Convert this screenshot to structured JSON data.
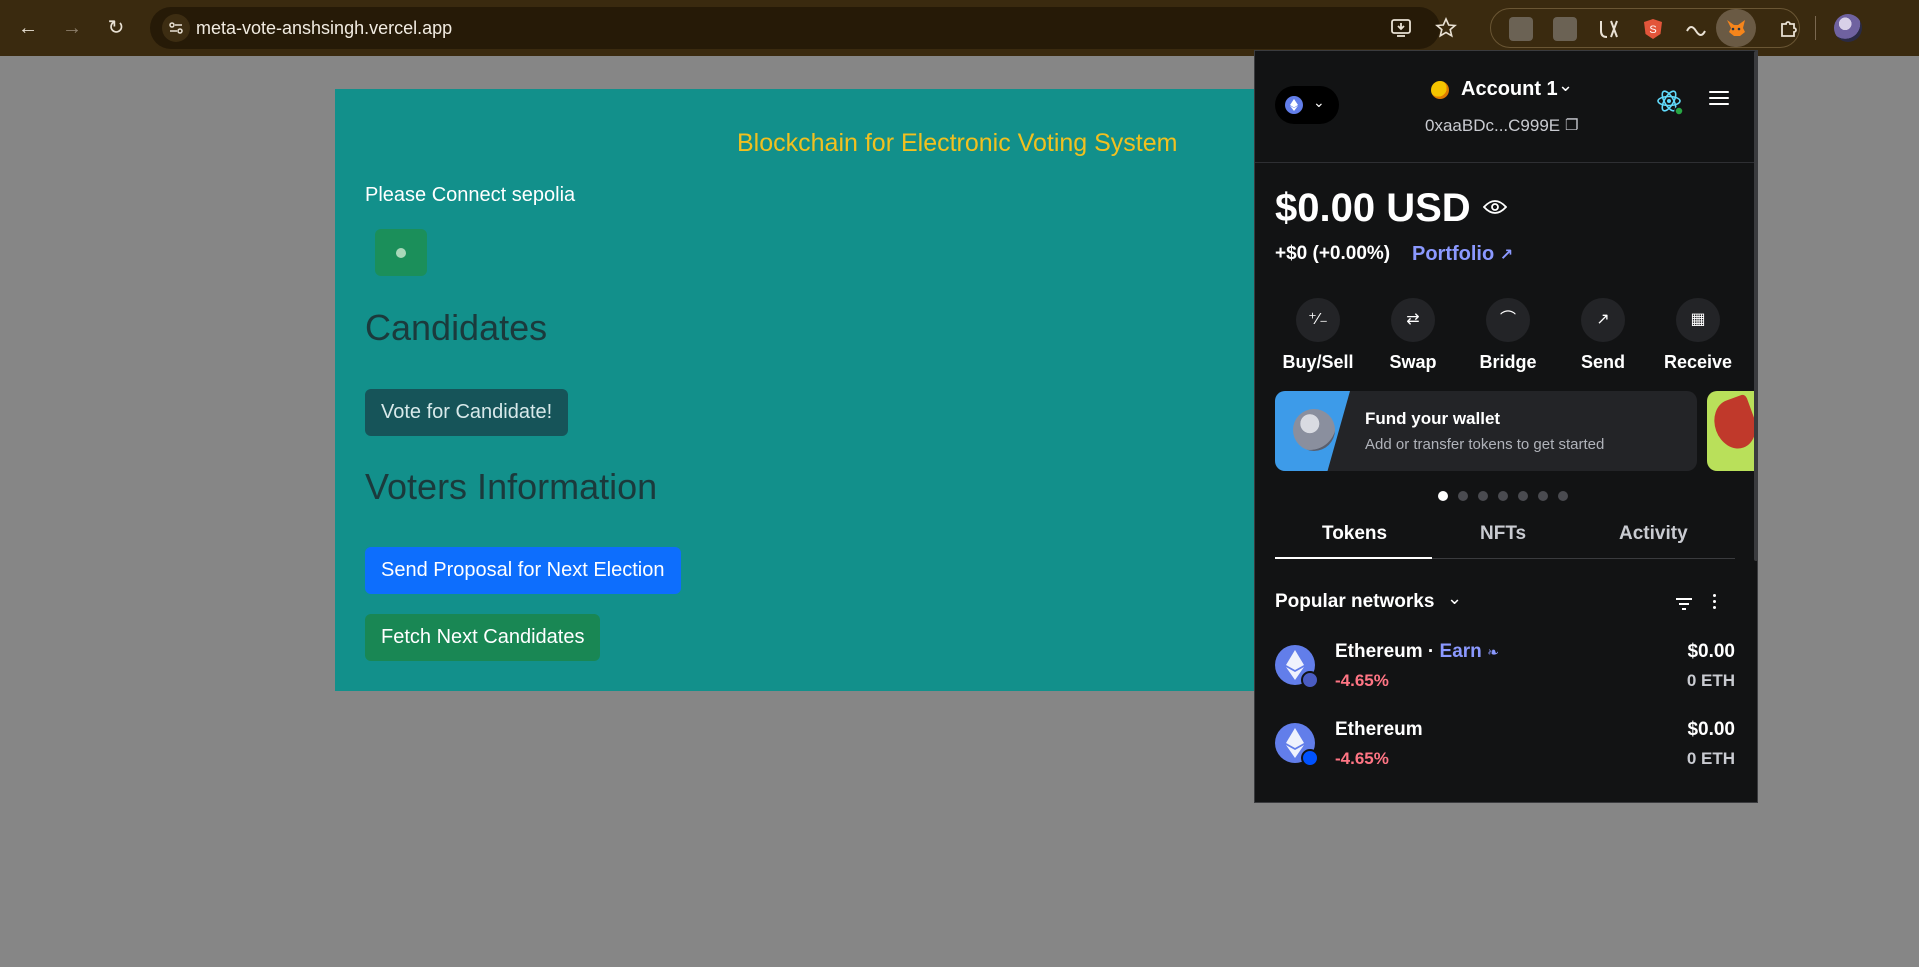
{
  "browser": {
    "url": "meta-vote-anshsingh.vercel.app"
  },
  "dapp": {
    "title": "Blockchain for Electronic Voting System",
    "connect_text": "Please Connect sepolia",
    "candidates_heading": "Candidates",
    "vote_button": "Vote for Candidate!",
    "voters_heading": "Voters Information",
    "send_proposal_button": "Send Proposal for Next Election",
    "fetch_button": "Fetch Next Candidates"
  },
  "wallet": {
    "account_name": "Account 1",
    "address": "0xaaBDc...C999E",
    "balance": "$0.00",
    "currency": "USD",
    "change": "+$0 (+0.00%)",
    "portfolio_link": "Portfolio",
    "actions": [
      {
        "label": "Buy/Sell",
        "icon": "buy-sell-icon"
      },
      {
        "label": "Swap",
        "icon": "swap-icon"
      },
      {
        "label": "Bridge",
        "icon": "bridge-icon"
      },
      {
        "label": "Send",
        "icon": "send-icon"
      },
      {
        "label": "Receive",
        "icon": "receive-icon"
      }
    ],
    "fund_card": {
      "title": "Fund your wallet",
      "subtitle": "Add or transfer tokens to get started"
    },
    "carousel_active": 1,
    "carousel_count": 7,
    "tabs": [
      "Tokens",
      "NFTs",
      "Activity"
    ],
    "active_tab": "Tokens",
    "networks_filter": "Popular networks",
    "tokens": [
      {
        "name": "Ethereum",
        "earn": "Earn",
        "change": "-4.65%",
        "fiat": "$0.00",
        "amount": "0 ETH"
      },
      {
        "name": "Ethereum",
        "change": "-4.65%",
        "fiat": "$0.00",
        "amount": "0 ETH"
      }
    ]
  },
  "colors": {
    "page_bg": "#868686",
    "dapp_bg": "#12908b",
    "title_yellow": "#f2c01f",
    "wallet_bg": "#121314",
    "accent_link": "#8b99ff",
    "negative": "#ff7584",
    "eth_blue": "#627eea"
  }
}
